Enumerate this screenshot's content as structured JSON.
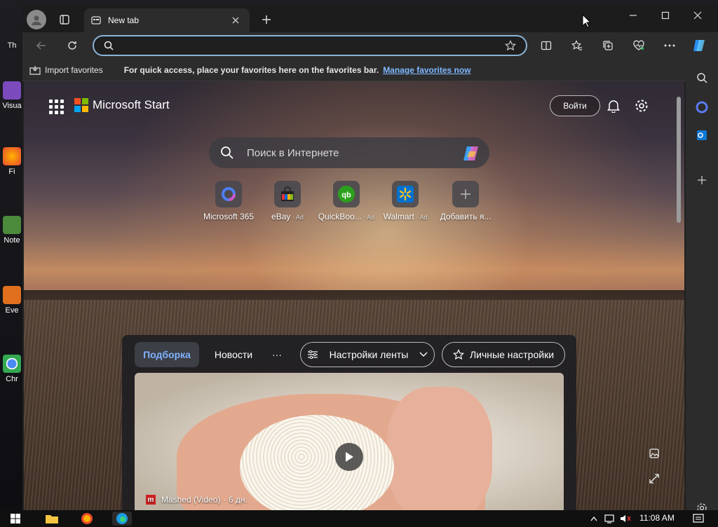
{
  "colors": {
    "accent": "#8ab4d8",
    "link": "#7fb9ff",
    "tab_active_text": "#7fb2ff"
  },
  "desktop": {
    "icons": [
      {
        "label": "Th",
        "icon": "desktop-shortcut-icon"
      },
      {
        "label": "Visua",
        "icon": "visual-studio-icon"
      },
      {
        "label": "Fi",
        "icon": "firefox-icon"
      },
      {
        "label": "Note",
        "icon": "notepad-icon"
      },
      {
        "label": "Eve",
        "icon": "app-icon"
      },
      {
        "label": "Chr",
        "icon": "chrome-icon"
      }
    ]
  },
  "browser": {
    "tab": {
      "title": "New tab"
    },
    "address": {
      "value": ""
    },
    "favorites_bar": {
      "import_label": "Import favorites",
      "hint": "For quick access, place your favorites here on the favorites bar.",
      "manage_link": "Manage favorites now"
    }
  },
  "newtab": {
    "brand": "Microsoft Start",
    "signin_label": "Войти",
    "search_placeholder": "Поиск в Интернете",
    "quick_links": [
      {
        "label": "Microsoft 365",
        "ad": ""
      },
      {
        "label": "eBay",
        "ad": "Ad"
      },
      {
        "label": "QuickBoo...",
        "ad": "Ad"
      },
      {
        "label": "Walmart",
        "ad": "Ad"
      },
      {
        "label": "Добавить я...",
        "ad": ""
      }
    ],
    "feed": {
      "tabs": [
        "Подборка",
        "Новости",
        "···"
      ],
      "feed_settings": "Настройки ленты",
      "personal_settings": "Личные настройки",
      "card": {
        "source": "Mashed (Video)",
        "age": "· 6 дн."
      }
    }
  },
  "taskbar": {
    "time": "11:08 AM"
  }
}
